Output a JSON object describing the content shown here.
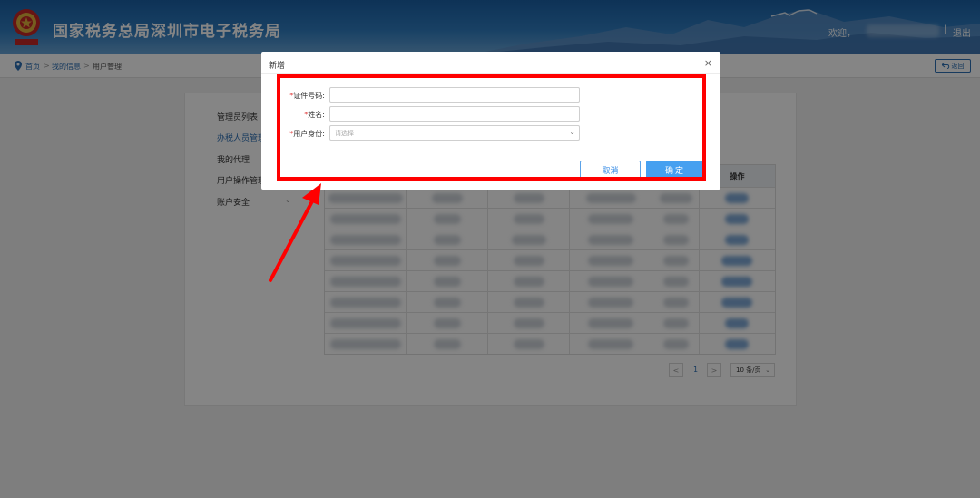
{
  "header": {
    "title": "国家税务总局深圳市电子税务局",
    "welcome": "欢迎，",
    "separator": "|",
    "logout": "退出"
  },
  "breadcrumb": {
    "items": [
      "首页",
      "我的信息",
      "用户管理"
    ],
    "separator": ">",
    "back_label": "返回"
  },
  "sidebar": {
    "items": [
      {
        "label": "管理员列表"
      },
      {
        "label": "办税人员管理"
      },
      {
        "label": "我的代理"
      },
      {
        "label": "用户操作管理"
      },
      {
        "label": "账户安全"
      }
    ]
  },
  "table": {
    "header_action": "操作"
  },
  "pager": {
    "prev": "<",
    "current_page": "1",
    "next": ">",
    "page_size": "10 条/页"
  },
  "dialog": {
    "title": "新增",
    "close": "×",
    "fields": [
      {
        "required": "*",
        "label": "证件号码:",
        "value": ""
      },
      {
        "required": "*",
        "label": "姓名:",
        "value": ""
      },
      {
        "required": "*",
        "label": "用户身份:",
        "placeholder": "请选择"
      }
    ],
    "cancel_label": "取消",
    "ok_label": "确定"
  },
  "colors": {
    "brand_blue": "#1b61a6",
    "primary_button": "#46a0f0",
    "annotation_red": "#ff0000",
    "required_star": "#e03b3b"
  }
}
